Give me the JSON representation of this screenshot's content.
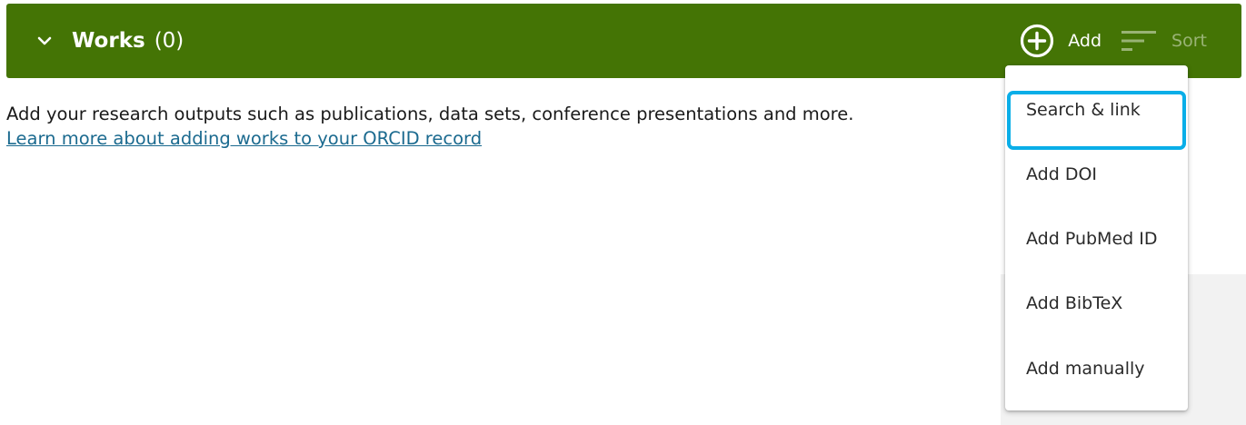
{
  "header": {
    "title": "Works",
    "count": "(0)",
    "add_label": "Add",
    "sort_label": "Sort",
    "background_color": "#447405"
  },
  "intro": {
    "text": "Add your research outputs such as publications, data sets, conference presentations and more.",
    "link_text": "Learn more about adding works to your ORCID record"
  },
  "menu": {
    "items": [
      {
        "label": "Search & link",
        "focused": true
      },
      {
        "label": "Add DOI"
      },
      {
        "label": "Add PubMed ID"
      },
      {
        "label": "Add BibTeX"
      },
      {
        "label": "Add manually"
      }
    ],
    "focus_color": "#0aaee8"
  }
}
